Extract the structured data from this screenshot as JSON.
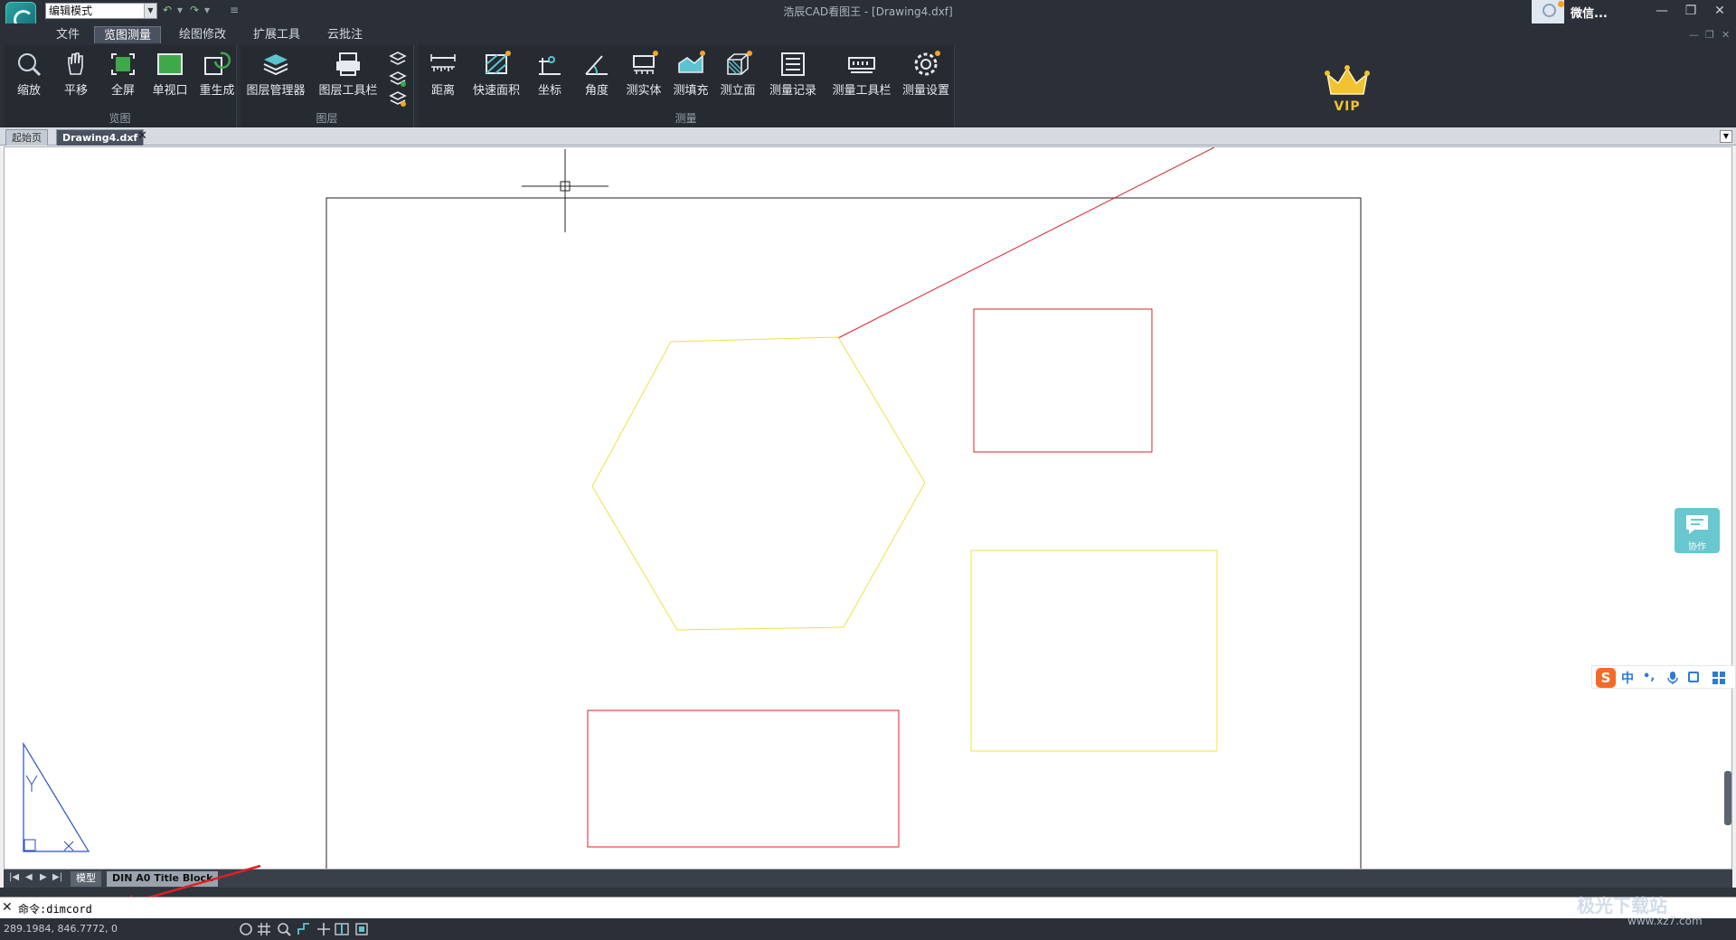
{
  "titlebar": {
    "mode_select": "编辑模式",
    "title": "浩辰CAD看图王 - [Drawing4.dxf]",
    "user_name": "微信..."
  },
  "menu": {
    "tabs": [
      "文件",
      "览图测量",
      "绘图修改",
      "扩展工具",
      "云批注"
    ],
    "active": "览图测量"
  },
  "ribbon": {
    "groups": [
      {
        "label": "览图",
        "tools": [
          "缩放",
          "平移",
          "全屏",
          "单视口",
          "重生成"
        ]
      },
      {
        "label": "图层",
        "tools": [
          "图层管理器",
          "图层工具栏"
        ]
      },
      {
        "label": "测量",
        "tools": [
          "距离",
          "快速面积",
          "坐标",
          "角度",
          "测实体",
          "测填充",
          "测立面",
          "测量记录",
          "测量工具栏",
          "测量设置"
        ]
      }
    ],
    "vip": "VIP"
  },
  "doc_tabs": [
    {
      "label": "起始页",
      "active": false
    },
    {
      "label": "Drawing4.dxf",
      "active": true
    }
  ],
  "collab_label": "协作",
  "ime": {
    "zh": "中"
  },
  "layout_tabs": [
    {
      "label": "模型"
    },
    {
      "label": "DIN A0 Title Block"
    }
  ],
  "command": {
    "text": "命令:dimcord"
  },
  "status": {
    "coords": "289.1984, 846.7772, 0"
  },
  "watermark": {
    "text": "极光下载站",
    "sub": "www.xz7.com"
  },
  "colors": {
    "ui_dark": "#2b3038",
    "red_entity": "#d9242b",
    "yellow_entity": "#f0e040",
    "ucs_blue": "#2a4fc0",
    "annotation_arrow": "#e02020"
  },
  "icons": {
    "ribbon": [
      "zoom-icon",
      "pan-icon",
      "fullscreen-icon",
      "single-viewport-icon",
      "regen-icon",
      "layer-manager-icon",
      "layer-toolbar-icon",
      "distance-icon",
      "quick-area-icon",
      "coordinate-icon",
      "angle-icon",
      "measure-solid-icon",
      "measure-hatch-icon",
      "measure-elevation-icon",
      "measure-record-icon",
      "measure-toolbar-icon",
      "measure-settings-icon"
    ]
  }
}
